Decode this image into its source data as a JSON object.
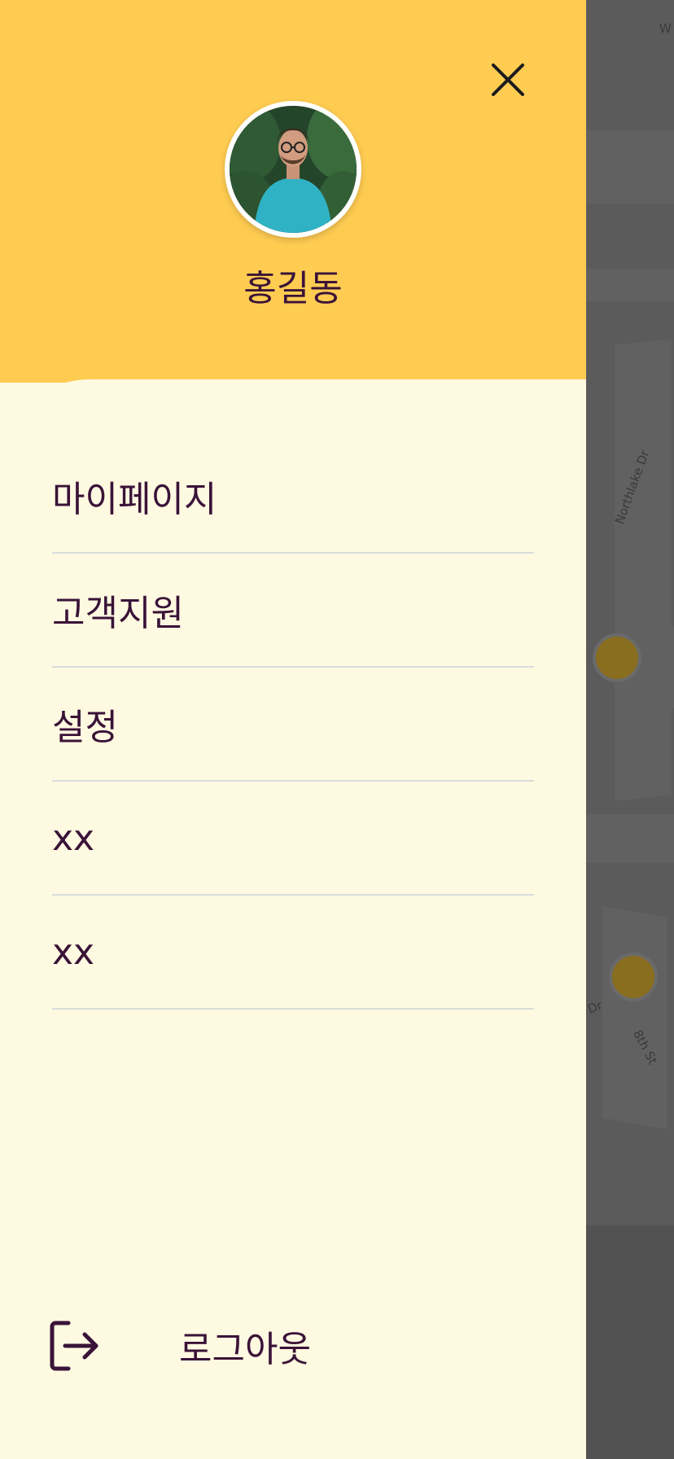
{
  "drawer": {
    "user_name": "홍길동",
    "menu_items": [
      {
        "label": "마이페이지"
      },
      {
        "label": "고객지원"
      },
      {
        "label": "설정"
      },
      {
        "label": "xx"
      },
      {
        "label": "xx"
      }
    ],
    "logout_label": "로그아웃"
  },
  "map": {
    "street_labels": [
      "Northlake Dr",
      "8th St",
      "Dr",
      "W"
    ]
  },
  "icons": {
    "close": "close-icon",
    "avatar": "avatar-photo",
    "logout": "logout-icon"
  },
  "colors": {
    "header": "#ffcc52",
    "drawer_body": "#fef9e1",
    "text": "#3a1338",
    "divider": "#d8dedb",
    "map_overlay": "#555555",
    "map_marker": "#8a6e1f"
  }
}
